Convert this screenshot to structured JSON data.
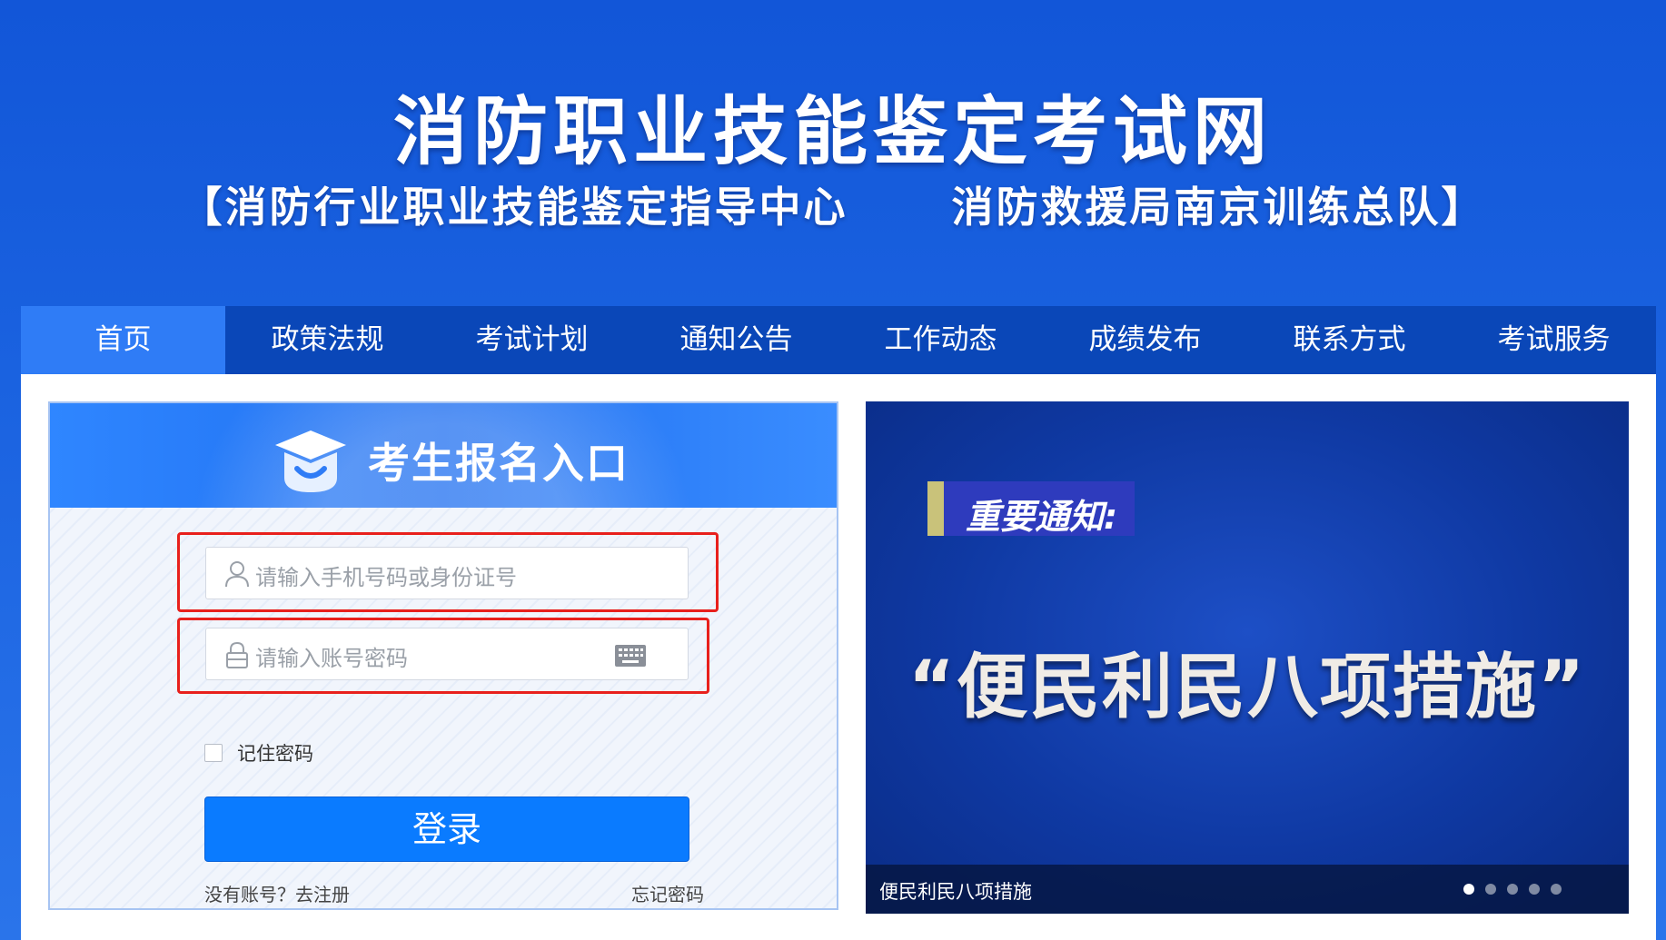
{
  "header": {
    "title": "消防职业技能鉴定考试网",
    "subtitle": "【消防行业职业技能鉴定指导中心      消防救援局南京训练总队】"
  },
  "nav": {
    "items": [
      "首页",
      "政策法规",
      "考试计划",
      "通知公告",
      "工作动态",
      "成绩发布",
      "联系方式",
      "考试服务"
    ],
    "active_index": 0
  },
  "login": {
    "title": "考生报名入口",
    "username_placeholder": "请输入手机号码或身份证号",
    "password_placeholder": "请输入账号密码",
    "remember_label": "记住密码",
    "login_button": "登录",
    "register_link": "没有账号？去注册",
    "forgot_link": "忘记密码"
  },
  "carousel": {
    "notice_tag": "重要通知:",
    "headline": "“便民利民八项措施”",
    "caption": "便民利民八项措施",
    "dot_count": 5,
    "active_dot": 1
  },
  "colors": {
    "header_blue": "#1256d8",
    "nav_blue": "#0a47b8",
    "nav_active": "#2f7cf6",
    "button_blue": "#0a7bff",
    "highlight_red": "#e8201c"
  }
}
